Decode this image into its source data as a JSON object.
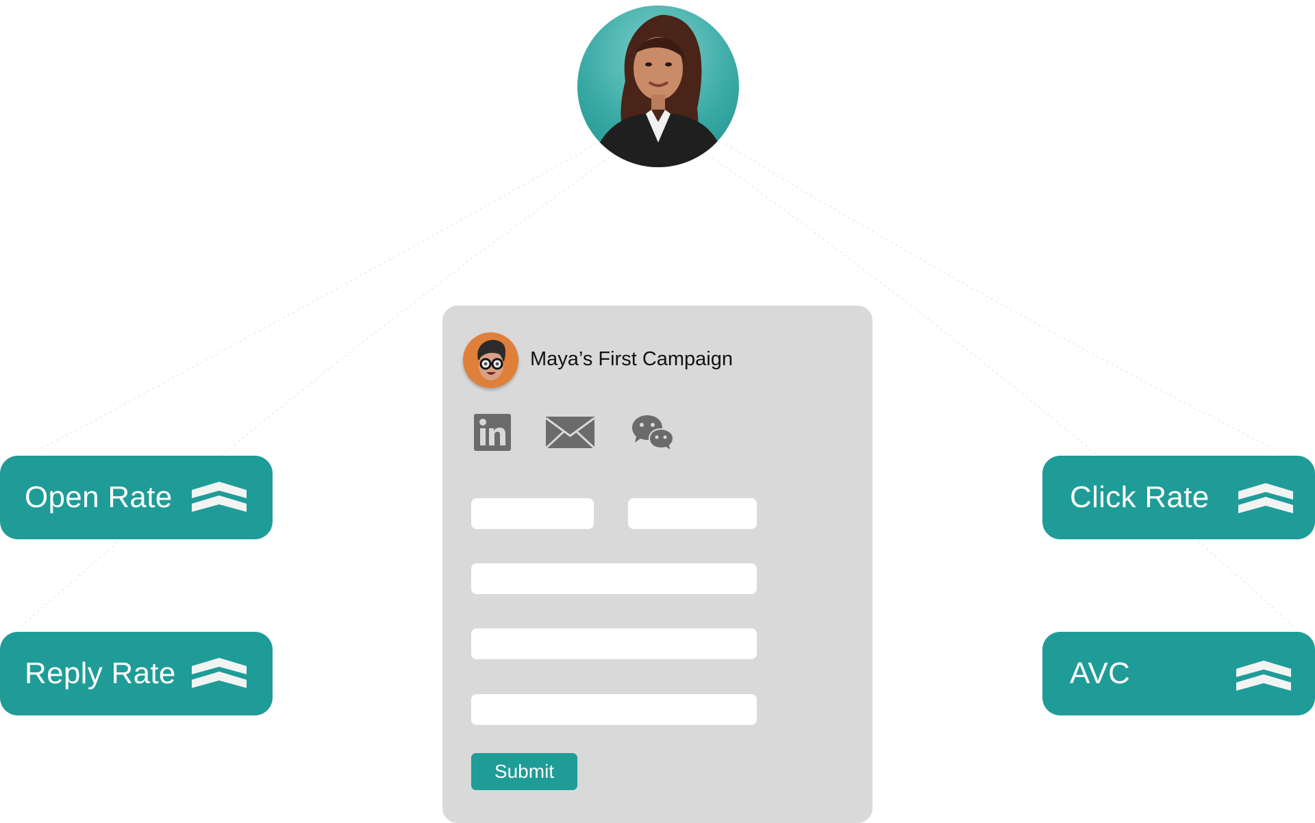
{
  "profile": {
    "photo": "profile-photo-woman"
  },
  "campaign": {
    "avatar": "memoji-avatar",
    "title": "Maya’s First Campaign",
    "channels": [
      {
        "name": "linkedin",
        "icon": "linkedin-icon"
      },
      {
        "name": "email",
        "icon": "mail-icon"
      },
      {
        "name": "wechat",
        "icon": "wechat-icon"
      }
    ],
    "form": {
      "fields": [
        {
          "name": "first-name",
          "value": "",
          "placeholder": ""
        },
        {
          "name": "last-name",
          "value": "",
          "placeholder": ""
        },
        {
          "name": "field-3",
          "value": "",
          "placeholder": ""
        },
        {
          "name": "field-4",
          "value": "",
          "placeholder": ""
        },
        {
          "name": "field-5",
          "value": "",
          "placeholder": ""
        }
      ],
      "submit_label": "Submit"
    }
  },
  "metrics": [
    {
      "label": "Open Rate",
      "icon": "double-chevron-up-icon"
    },
    {
      "label": "Reply Rate",
      "icon": "double-chevron-up-icon"
    },
    {
      "label": "Click Rate",
      "icon": "double-chevron-up-icon"
    },
    {
      "label": "AVC",
      "icon": "double-chevron-up-icon"
    }
  ],
  "colors": {
    "accent": "#1f9c98",
    "card": "#d9d9d9",
    "icon": "#6b6b6b",
    "avatar_bg": "#e07f3a"
  }
}
